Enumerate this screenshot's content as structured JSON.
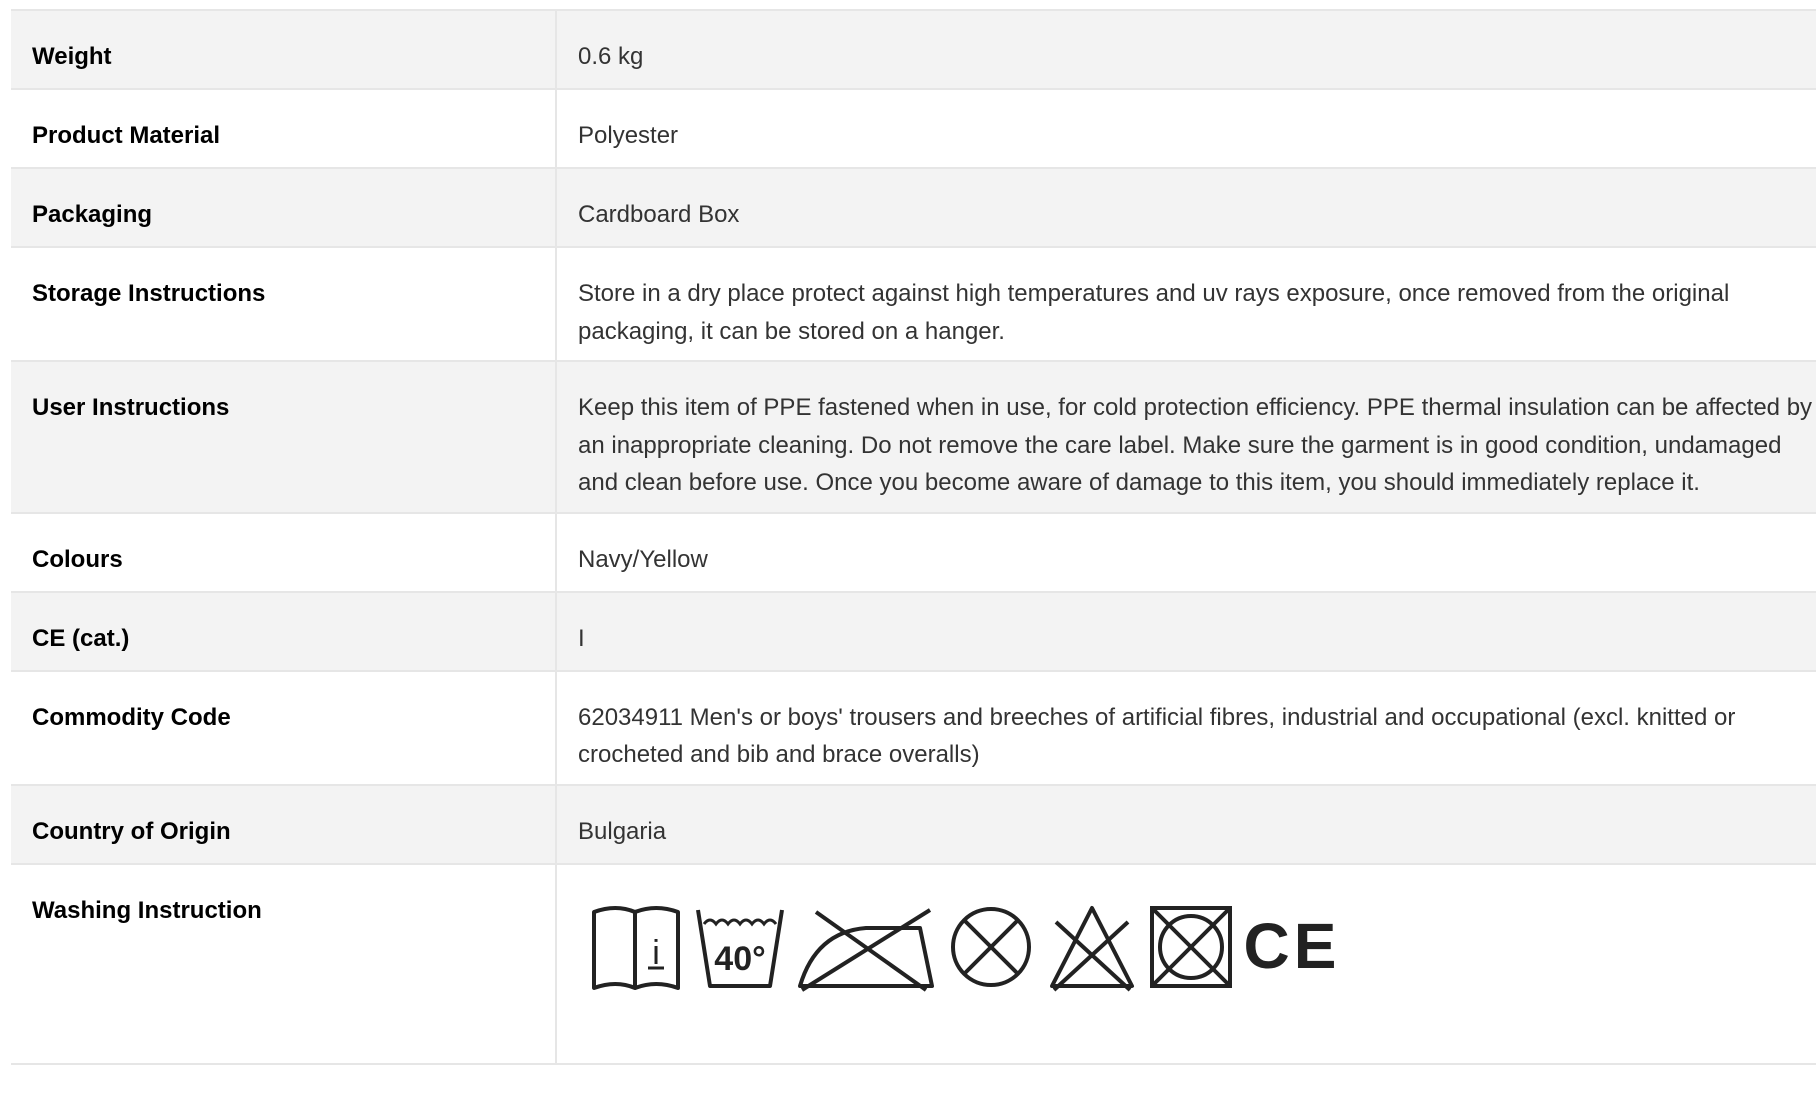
{
  "specs": [
    {
      "label": "Weight",
      "value": "0.6 kg"
    },
    {
      "label": "Product Material",
      "value": "Polyester"
    },
    {
      "label": "Packaging",
      "value": "Cardboard Box"
    },
    {
      "label": "Storage Instructions",
      "value": "Store in a dry place protect against high temperatures and uv rays exposure, once removed from the original packaging, it can be stored on a hanger."
    },
    {
      "label": "User Instructions",
      "value": "Keep this item of PPE fastened when in use, for cold protection efficiency. PPE thermal insulation can be affected by an inappropriate cleaning. Do not remove the care label. Make sure the garment is in good condition, undamaged and clean before use. Once you become aware of damage to this item, you should immediately replace it."
    },
    {
      "label": "Colours",
      "value": "Navy/Yellow"
    },
    {
      "label": "CE (cat.)",
      "value": "I"
    },
    {
      "label": "Commodity Code",
      "value": "62034911 Men's or boys' trousers and breeches of artificial fibres, industrial and occupational (excl. knitted or crocheted and bib and brace overalls)"
    },
    {
      "label": "Country of Origin",
      "value": "Bulgaria"
    }
  ],
  "washing": {
    "label": "Washing Instruction",
    "icons": [
      "read-instructions-icon",
      "wash-40-icon",
      "do-not-iron-icon",
      "do-not-dry-clean-icon",
      "do-not-bleach-icon",
      "do-not-tumble-dry-icon",
      "ce-mark-icon"
    ],
    "wash_temp": "40°",
    "info_glyph": "i",
    "ce_text": "CE"
  },
  "colors": {
    "row_alt": "#f3f3f3",
    "border": "#e6e6e6",
    "label_text": "#000000",
    "value_text": "#333333"
  }
}
